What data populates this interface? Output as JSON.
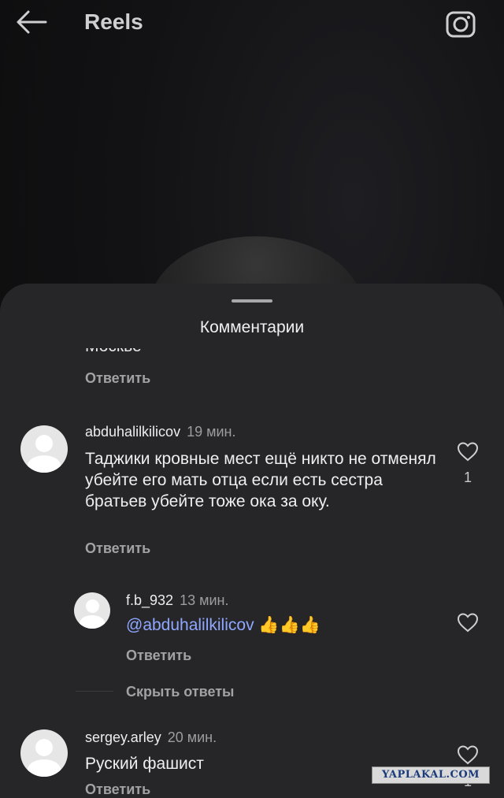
{
  "header": {
    "title": "Reels",
    "back_icon": "arrow-left-icon",
    "camera_icon": "camera-icon"
  },
  "sheet": {
    "title": "Комментарии"
  },
  "partial_comment": {
    "text_fragment": "Москве",
    "reply_label": "Ответить"
  },
  "comments": [
    {
      "username": "abduhalilkilicov",
      "time": "19 мин.",
      "text": "Таджики кровные мест ещё никто не отменял убейте его мать отца если есть сестра братьев убейте тоже ока за оку.",
      "likes": "1",
      "reply_label": "Ответить",
      "replies": [
        {
          "username": "f.b_932",
          "time": "13 мин.",
          "mention": "@abduhalilkilicov",
          "emoji": "👍👍👍",
          "reply_label": "Ответить"
        }
      ],
      "hide_replies_label": "Скрыть ответы"
    },
    {
      "username": "sergey.arley",
      "time": "20 мин.",
      "text": "Руский фашист",
      "likes": "1",
      "reply_label": "Ответить"
    }
  ],
  "watermark": "YAPLAKAL.COM",
  "colors": {
    "sheet_bg": "#262629",
    "mention": "#8fa8ff",
    "emoji": "#f3b82c"
  }
}
